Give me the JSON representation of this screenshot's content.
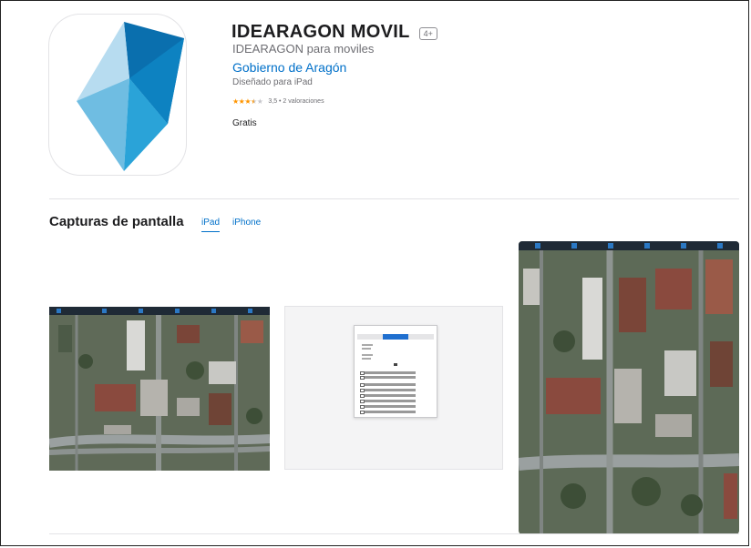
{
  "app": {
    "title": "IDEARAGON MOVIL",
    "age_rating": "4+",
    "subtitle": "IDEARAGON para moviles",
    "developer": "Gobierno de Aragón",
    "designed_for": "Diseñado para iPad",
    "rating_text": "3,5 • 2 valoraciones",
    "rating_value": 3.5,
    "rating_max": 5,
    "price": "Gratis"
  },
  "screenshots": {
    "section_title": "Capturas de pantalla",
    "tabs": [
      {
        "label": "iPad",
        "active": true
      },
      {
        "label": "iPhone",
        "active": false
      }
    ]
  },
  "colors": {
    "link": "#0070c9",
    "star": "#ff9500",
    "icon_dark": "#0a6fae",
    "icon_mid": "#1f97cf",
    "icon_light": "#8fcbe7",
    "icon_pale": "#c4e3f3"
  }
}
